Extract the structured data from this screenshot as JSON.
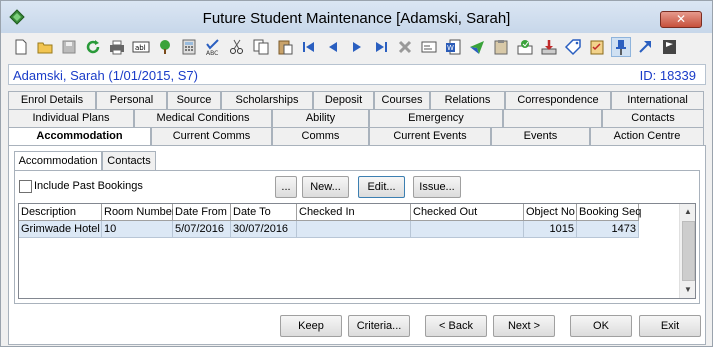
{
  "window": {
    "title": "Future Student Maintenance  [Adamski, Sarah]",
    "close_label": "✕"
  },
  "toolbar": {
    "icons": [
      "new-icon",
      "open-icon",
      "save-icon",
      "refresh-icon",
      "print-icon",
      "label-icon",
      "tree-icon",
      "calculator-icon",
      "spellcheck-icon",
      "cut-icon",
      "copy-icon",
      "paste-icon",
      "first-record-icon",
      "previous-record-icon",
      "next-record-icon",
      "last-record-icon",
      "delete-icon",
      "card-icon",
      "word-icon",
      "send-icon",
      "clipboard-icon",
      "mail-icon",
      "download-icon",
      "tag-icon",
      "checklist-icon",
      "pin-icon",
      "arrow-icon",
      "flag-icon"
    ]
  },
  "student": {
    "name": "Adamski, Sarah (1/01/2015, S7)",
    "id": "ID: 18339"
  },
  "tabs": {
    "row1": [
      "Enrol Details",
      "Personal",
      "Source",
      "Scholarships",
      "Deposit",
      "Courses",
      "Relations",
      "Correspondence",
      "International"
    ],
    "row2": [
      "Individual Plans",
      "Medical Conditions",
      "Ability",
      "Emergency",
      "",
      "Contacts"
    ],
    "row3": [
      "Accommodation",
      "Current Comms",
      "Comms",
      "Current Events",
      "Events",
      "Action Centre"
    ]
  },
  "subtabs": [
    "Accommodation",
    "Contacts"
  ],
  "filter": {
    "include_past_label": "Include Past Bookings",
    "include_past_checked": false
  },
  "actions": {
    "more_label": "...",
    "new_label": "New...",
    "edit_label": "Edit...",
    "issue_label": "Issue..."
  },
  "grid": {
    "columns": [
      "Description",
      "Room Number",
      "Date From",
      "Date To",
      "Checked In",
      "Checked Out",
      "Object No",
      "Booking Seq"
    ],
    "rows": [
      [
        "Grimwade Hotel",
        "10",
        "5/07/2016",
        "30/07/2016",
        "",
        "",
        "1015",
        "1473"
      ]
    ]
  },
  "footer": {
    "keep_label": "Keep",
    "criteria_label": "Criteria...",
    "back_label": "< Back",
    "next_label": "Next >",
    "ok_label": "OK",
    "exit_label": "Exit"
  }
}
